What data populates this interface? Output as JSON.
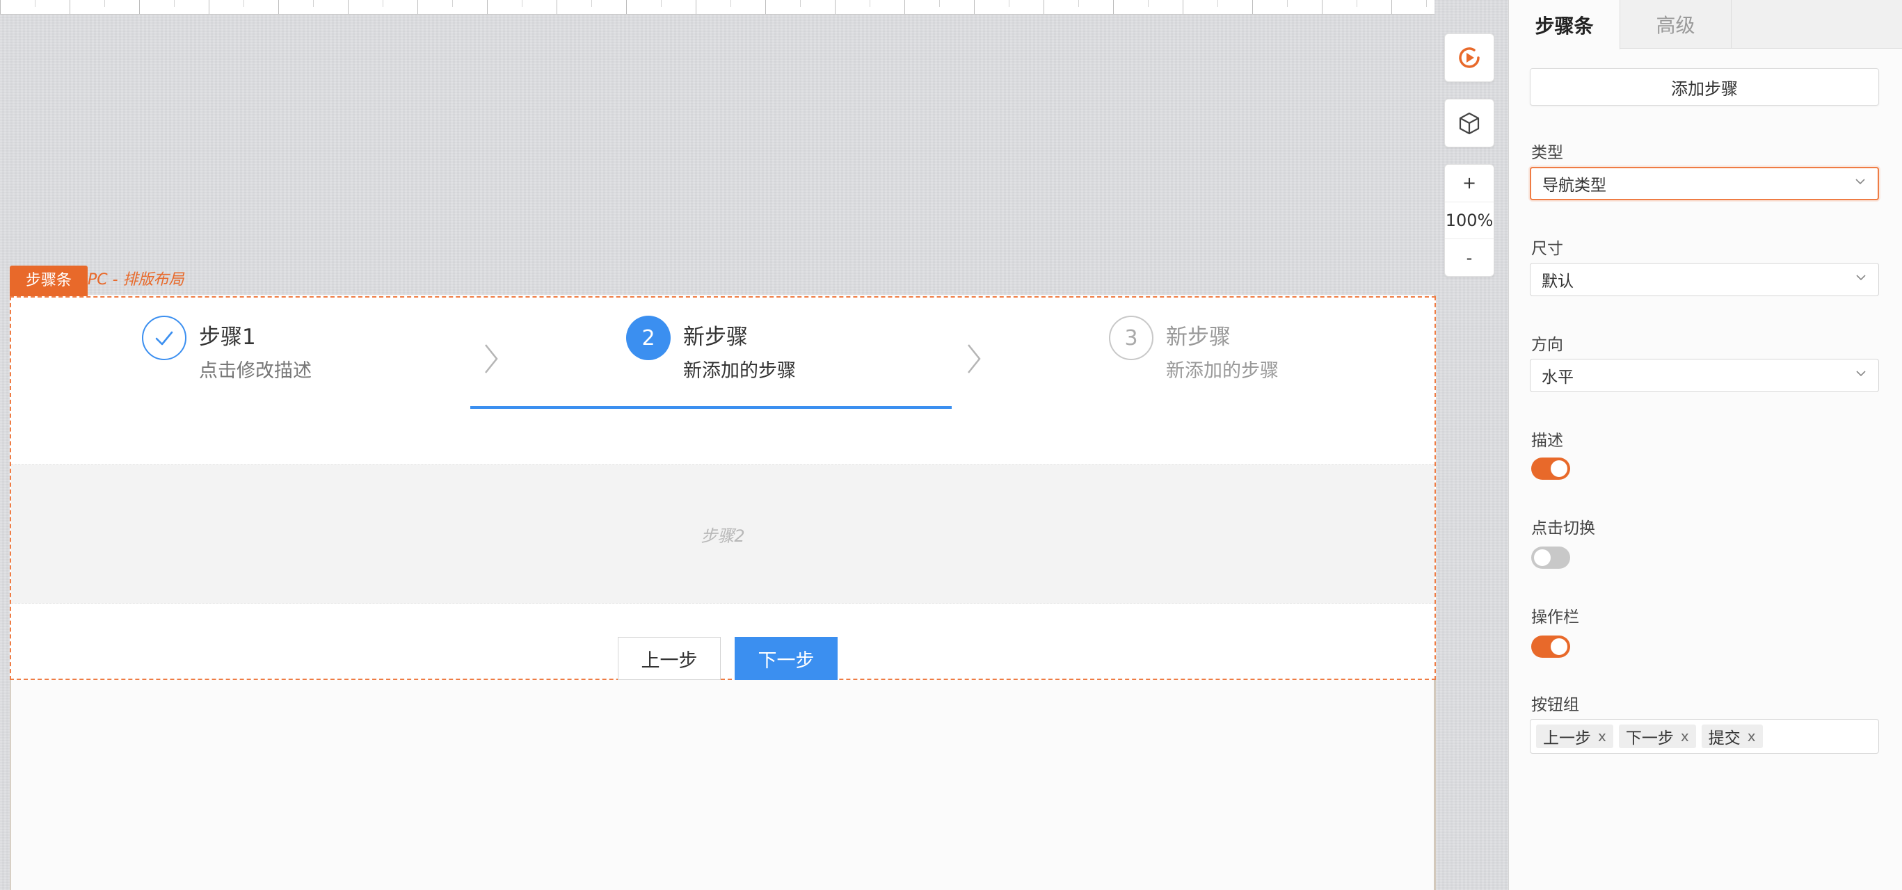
{
  "canvas": {
    "zoom_in": "+",
    "zoom_level": "100%",
    "zoom_out": "-"
  },
  "component": {
    "tag": "步骤条",
    "subtitle": "PC - 排版布局"
  },
  "steps": [
    {
      "index": "✓",
      "title": "步骤1",
      "desc": "点击修改描述",
      "status": "finished"
    },
    {
      "index": "2",
      "title": "新步骤",
      "desc": "新添加的步骤",
      "status": "active"
    },
    {
      "index": "3",
      "title": "新步骤",
      "desc": "新添加的步骤",
      "status": "waiting"
    }
  ],
  "content_placeholder": "步骤2",
  "actions": {
    "prev": "上一步",
    "next": "下一步"
  },
  "panel": {
    "tabs": [
      {
        "label": "步骤条"
      },
      {
        "label": "高级"
      }
    ],
    "add_step": "添加步骤",
    "type": {
      "label": "类型",
      "value": "导航类型"
    },
    "size": {
      "label": "尺寸",
      "value": "默认"
    },
    "direction": {
      "label": "方向",
      "value": "水平"
    },
    "description": {
      "label": "描述",
      "enabled": true
    },
    "click_switch": {
      "label": "点击切换",
      "enabled": false
    },
    "action_bar": {
      "label": "操作栏",
      "enabled": true
    },
    "button_group": {
      "label": "按钮组",
      "tags": [
        "上一步",
        "下一步",
        "提交"
      ],
      "remove": "x"
    }
  },
  "colors": {
    "accent": "#e8692a",
    "primary": "#3b8ff0"
  }
}
